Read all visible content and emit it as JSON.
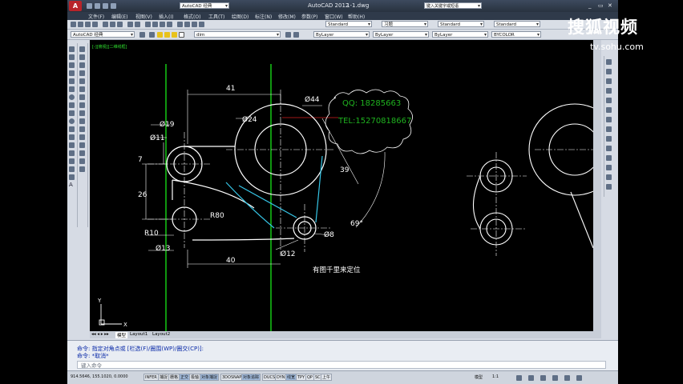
{
  "window": {
    "workspace": "AutoCAD 经典",
    "app_title": "AutoCAD 2012",
    "file_name": "1-1.dwg",
    "search_placeholder": "键入关键字或短语"
  },
  "menu": [
    "文件(F)",
    "编辑(E)",
    "视图(V)",
    "插入(I)",
    "格式(O)",
    "工具(T)",
    "绘图(D)",
    "标注(N)",
    "修改(M)",
    "参数(P)",
    "窗口(W)",
    "帮助(H)"
  ],
  "toolbar": {
    "workspace_combo": "AutoCAD 经典",
    "dim_style_combo": "dim",
    "layer_combo": "ByLayer",
    "text_style": "Standard",
    "text_style_2": "Standard",
    "table_style": "Standard",
    "multileader_style": "习题",
    "linetype_combo": "ByLayer",
    "lineweight_combo": "ByLayer",
    "color_combo": "BYCOLOR"
  },
  "viewport_label": "[-][俯视][二维线框]",
  "drawing": {
    "dims": [
      "41",
      "Ø44",
      "Ø24",
      "Ø19",
      "Ø11",
      "7",
      "26",
      "R80",
      "R10",
      "Ø13",
      "40",
      "Ø12",
      "Ø8",
      "39",
      "69°"
    ],
    "note": "有图千里来定位",
    "contact": [
      "QQ: 18285663",
      "TEL:15270818667"
    ]
  },
  "layout_tabs": [
    "模型",
    "Layout1",
    "Layout2"
  ],
  "command": {
    "lines": [
      "命令: 指定对角点或 [栏选(F)/圈围(WP)/圈交(CP)]:",
      "命令: *取消*"
    ],
    "prompt": "键入命令"
  },
  "status": {
    "coords": "914.5646, 155.1020, 0.0000",
    "buttons": [
      "INFER",
      "捕捉",
      "栅格",
      "正交",
      "极轴",
      "对象捕捉",
      "3DOSNAP",
      "对象追踪",
      "DUCS",
      "DYN",
      "线宽",
      "TPY",
      "QP",
      "SC",
      "上午"
    ],
    "model_label": "模型",
    "scale": "1:1"
  },
  "watermark": {
    "brand": "搜狐视频",
    "url": "tv.sohu.com"
  },
  "colors": {
    "canvas": "#000000",
    "green_line": "#19e619",
    "cyan_line": "#36c7e8",
    "red_line": "#d42020",
    "cloud_text": "#1fb21f"
  }
}
